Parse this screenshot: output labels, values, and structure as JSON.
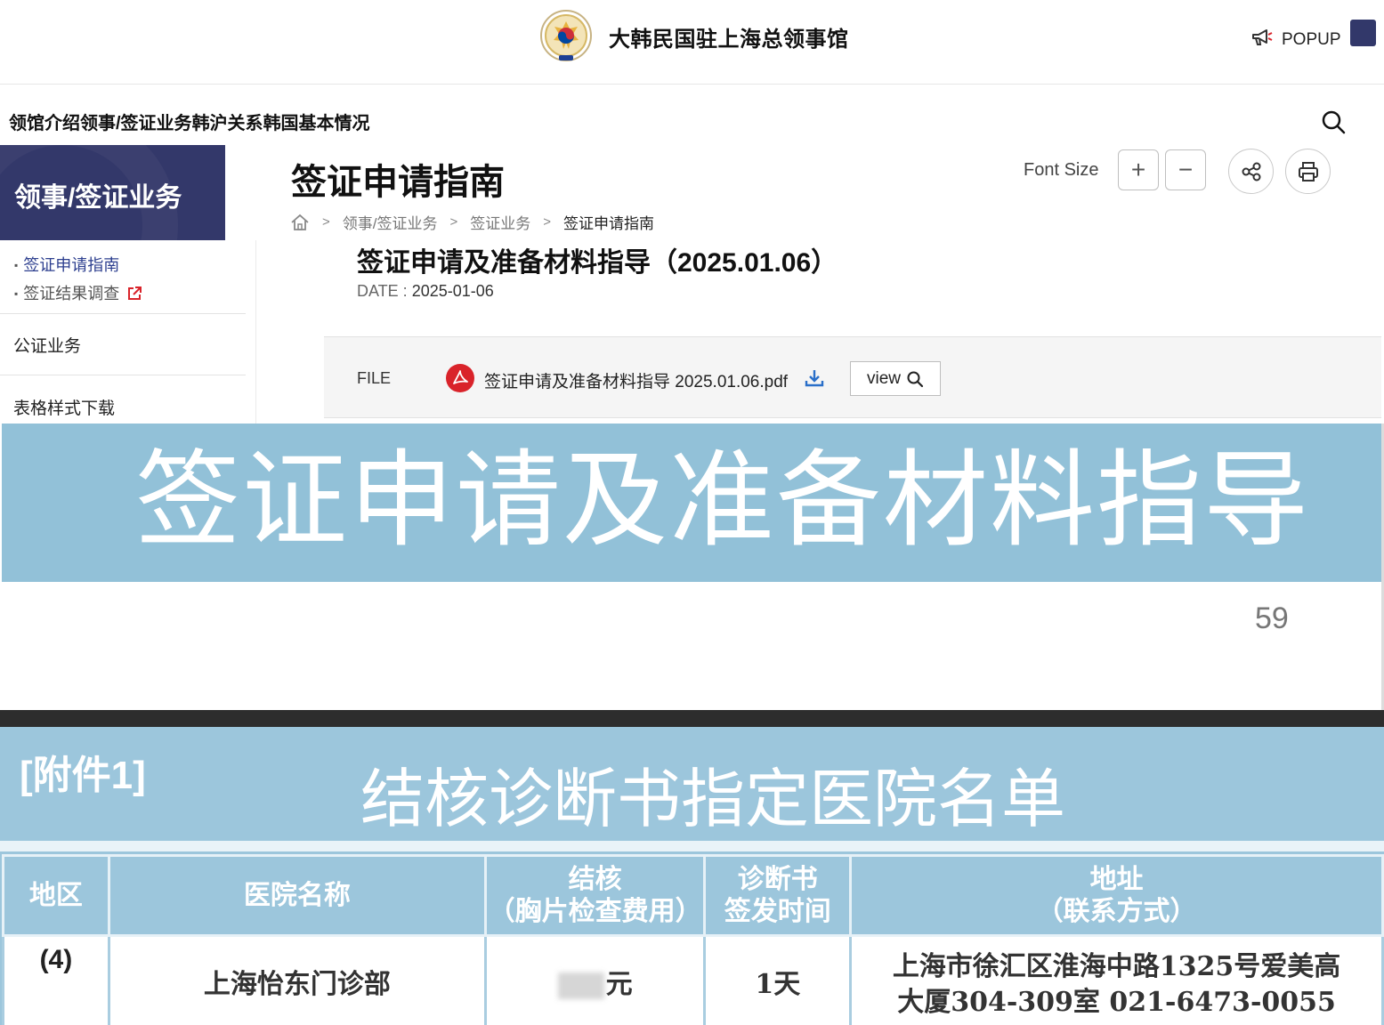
{
  "header": {
    "site_title": "大韩民国驻上海总领事馆",
    "popup_label": "POPUP"
  },
  "gnb": {
    "items": [
      "领馆介绍",
      "领事/签证业务",
      "韩沪关系",
      "韩国基本情况"
    ]
  },
  "sidebar": {
    "section_title": "领事/签证业务",
    "sub_items": [
      {
        "label": "签证申请指南",
        "active": true
      },
      {
        "label": "签证结果调查",
        "external": true
      }
    ],
    "menu_items": [
      "公证业务",
      "表格样式下载"
    ]
  },
  "content": {
    "page_title": "签证申请指南",
    "font_size_label": "Font Size",
    "font_plus": "+",
    "font_minus": "−",
    "breadcrumb": [
      "领事/签证业务",
      "签证业务",
      "签证申请指南"
    ],
    "post_title": "签证申请及准备材料指导（2025.01.06）",
    "date_label": "DATE : ",
    "date_value": "2025-01-06",
    "file_label": "FILE",
    "file_name": "签证申请及准备材料指导 2025.01.06.pdf",
    "view_label": "view"
  },
  "document": {
    "banner_title": "签证申请及准备材料指导",
    "page_number": "59",
    "attachment_label": "[附件1]",
    "table_title": "结核诊断书指定医院名单",
    "table_headers": [
      "地区",
      "医院名称",
      "结核\n（胸片检查费用）",
      "诊断书\n签发时间",
      "地址\n（联系方式）"
    ],
    "table_row": {
      "region": "(4)",
      "hospital": "上海怡东门诊部",
      "fee_unit": "元",
      "issue_time": "1天",
      "address": "上海市徐汇区淮海中路1325号爱美高\n大厦304-309室  021-6473-0055"
    }
  },
  "colors": {
    "navy": "#33386a",
    "doc_blue": "#92c1d8",
    "active_link": "#2d3f8f",
    "pdf_red": "#d9232a",
    "download_blue": "#2a6fc9"
  }
}
